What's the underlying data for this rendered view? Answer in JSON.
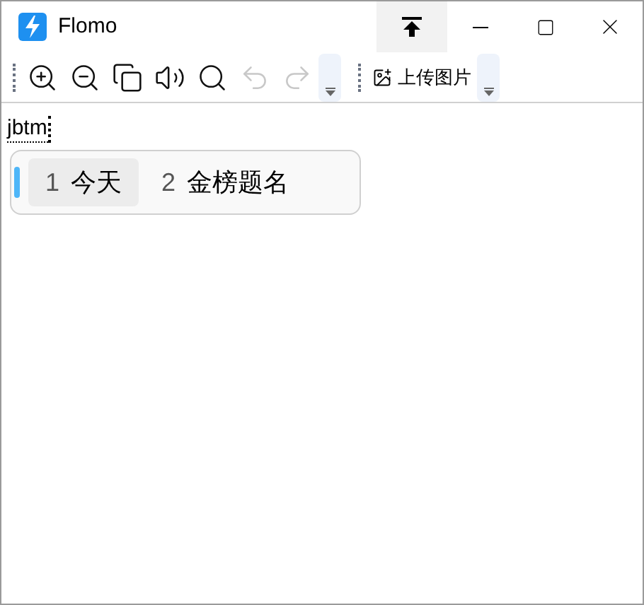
{
  "window": {
    "title": "Flomo"
  },
  "toolbar": {
    "buttons": [
      {
        "kind": "zoom-in",
        "disabled": false
      },
      {
        "kind": "zoom-out",
        "disabled": false
      },
      {
        "kind": "copy",
        "disabled": false
      },
      {
        "kind": "speaker",
        "disabled": false
      },
      {
        "kind": "search",
        "disabled": false
      },
      {
        "kind": "undo",
        "disabled": true
      },
      {
        "kind": "redo",
        "disabled": true
      }
    ],
    "upload_button": {
      "label": "上传图片"
    }
  },
  "composition": {
    "text": "jbtm"
  },
  "candidates": [
    {
      "number": "1",
      "text": "今天",
      "selected": true
    },
    {
      "number": "2",
      "text": "金榜题名",
      "selected": false
    }
  ]
}
